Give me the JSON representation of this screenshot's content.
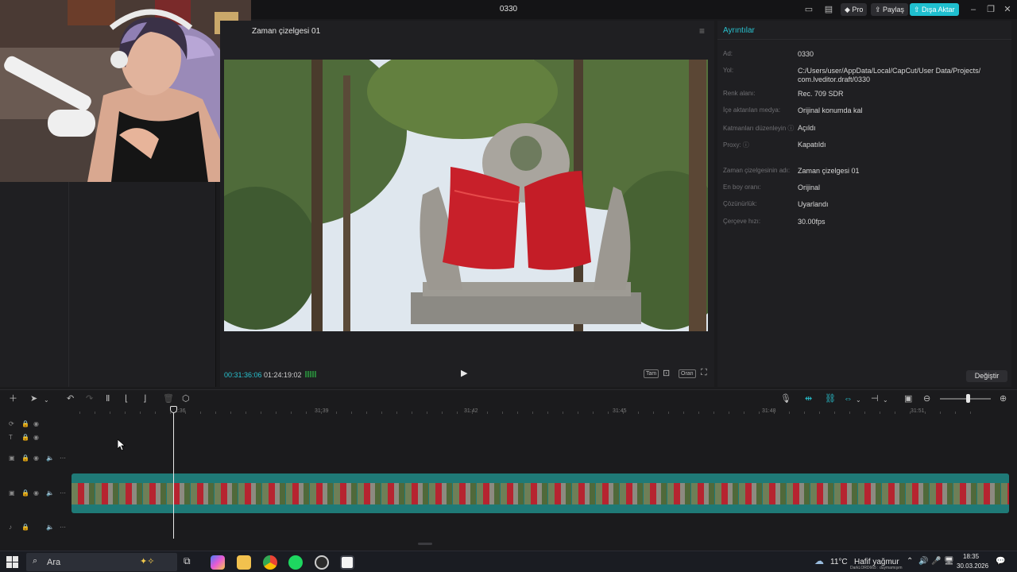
{
  "window": {
    "title": "0330",
    "pro_label": "Pro",
    "share_label": "Paylaş",
    "export_label": "Dışa Aktar"
  },
  "player": {
    "title": "Zaman çizelgesi 01",
    "current_time": "00:31:36:06",
    "total_time": "01:24:19:02",
    "controls": [
      "Tam",
      "Oran"
    ]
  },
  "details": {
    "header": "Ayrıntılar",
    "rows": [
      {
        "label": "Ad:",
        "value": "0330"
      },
      {
        "label": "Yol:",
        "value": "C:/Users/user/AppData/Local/CapCut/User Data/Projects/ com.lveditor.draft/0330"
      },
      {
        "label": "Renk alanı:",
        "value": "Rec. 709 SDR"
      },
      {
        "label": "İçe aktarılan medya:",
        "value": "Orijinal konumda kal"
      },
      {
        "label": "Katmanları düzenleyin ⓘ",
        "value": "Açıldı"
      },
      {
        "label": "Proxy: ⓘ",
        "value": "Kapatıldı"
      },
      {
        "label": "Zaman çizelgesinin adı:",
        "value": "Zaman çizelgesi 01"
      },
      {
        "label": "En boy oranı:",
        "value": "Orijinal"
      },
      {
        "label": "Çözünürlük:",
        "value": "Uyarlandı"
      },
      {
        "label": "Çerçeve hızı:",
        "value": "30.00fps"
      }
    ],
    "change_label": "Değiştir"
  },
  "timeline": {
    "ruler_labels": [
      "31:36",
      "31:39",
      "31:42",
      "31:45",
      "31:48",
      "31:51"
    ]
  },
  "taskbar": {
    "search_label": "Ara",
    "temperature": "11°C",
    "weather": "Hafif yağmur",
    "user": "DarkLORD665 : duymamışım",
    "time": "18:35",
    "date": "30.03.2026"
  },
  "colors": {
    "accent": "#29c2cf",
    "clip": "#1f7a77"
  }
}
